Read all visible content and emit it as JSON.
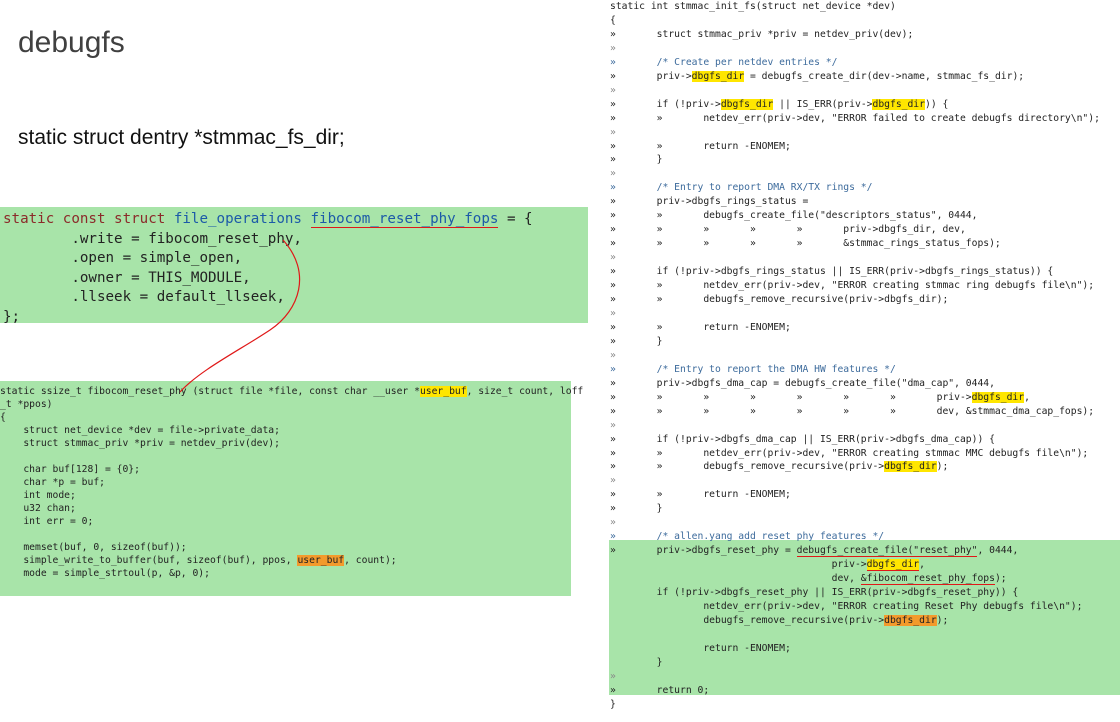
{
  "slide": {
    "title": "debugfs",
    "declaration": "static struct dentry *stmmac_fs_dir;"
  },
  "fops_block": {
    "line1_kw": "static const struct ",
    "line1_type": "file_operations",
    "line1_name": "fibocom_reset_phy_fops",
    "line1_end": " = {",
    "lines": [
      "        .write = fibocom_reset_phy,",
      "        .open = simple_open,",
      "        .owner = THIS_MODULE,",
      "        .llseek = default_llseek,",
      "};"
    ]
  },
  "reset_block": {
    "sig_a": "static ssize_t fibocom_reset_phy (struct file *file, const char __user *",
    "sig_hl": "user_buf",
    "sig_b": ", size_t count, loff",
    "sig_c": "_t *ppos)",
    "body_a": "{\n    struct net_device *dev = file->private_data;\n    struct stmmac_priv *priv = netdev_priv(dev);\n\n    char buf[128] = {0};\n    char *p = buf;\n    int mode;\n    u32 chan;\n    int err = 0;\n\n    memset(buf, 0, sizeof(buf));\n    simple_write_to_buffer(buf, sizeof(buf), ppos, ",
    "body_hl": "user_buf",
    "body_b": ", count);\n    mode = simple_strtoul(p, &p, 0);"
  },
  "right_code": {
    "l1": "static int stmmac_init_fs(struct net_device *dev)",
    "l2": "{",
    "l3": "»       struct stmmac_priv *priv = netdev_priv(dev);",
    "l5": "»       /* Create per netdev entries */",
    "l6a": "»       priv->",
    "l6b": " = debugfs_create_dir(dev->name, stmmac_fs_dir);",
    "l8a": "»       if (!priv->",
    "l8b": " || IS_ERR(priv->",
    "l8c": ")) {",
    "l9": "»       »       netdev_err(priv->dev, \"ERROR failed to create debugfs directory\\n\");",
    "l11": "»       »       return -ENOMEM;",
    "l12": "»       }",
    "l14": "»       /* Entry to report DMA RX/TX rings */",
    "l15": "»       priv->dbgfs_rings_status =",
    "l16": "»       »       debugfs_create_file(\"descriptors_status\", 0444,",
    "l17": "»       »       »       »       »       priv->dbgfs_dir, dev,",
    "l18": "»       »       »       »       »       &stmmac_rings_status_fops);",
    "l20": "»       if (!priv->dbgfs_rings_status || IS_ERR(priv->dbgfs_rings_status)) {",
    "l21": "»       »       netdev_err(priv->dev, \"ERROR creating stmmac ring debugfs file\\n\");",
    "l22": "»       »       debugfs_remove_recursive(priv->dbgfs_dir);",
    "l24": "»       »       return -ENOMEM;",
    "l25": "»       }",
    "l27": "»       /* Entry to report the DMA HW features */",
    "l28": "»       priv->dbgfs_dma_cap = debugfs_create_file(\"dma_cap\", 0444,",
    "l29a": "»       »       »       »       »       »       »       priv->",
    "l29b": ",",
    "l30": "»       »       »       »       »       »       »       dev, &stmmac_dma_cap_fops);",
    "l32": "»       if (!priv->dbgfs_dma_cap || IS_ERR(priv->dbgfs_dma_cap)) {",
    "l33": "»       »       netdev_err(priv->dev, \"ERROR creating stmmac MMC debugfs file\\n\");",
    "l34a": "»       »       debugfs_remove_recursive(priv->",
    "l34b": ");",
    "l36": "»       »       return -ENOMEM;",
    "l37": "»       }",
    "l39": "»       /* allen.yang add reset phy features */",
    "l40a": "»       priv->dbgfs_reset_phy = ",
    "l40b": "debugfs_create_file(\"reset_phy\"",
    "l40c": ", 0444,",
    "l41a": "                                      priv->",
    "l41b": ",",
    "l42a": "                                      dev, ",
    "l42b": "&fibocom_reset_phy_fops",
    "l42c": ");",
    "l43": "        if (!priv->dbgfs_reset_phy || IS_ERR(priv->dbgfs_reset_phy)) {",
    "l44": "                netdev_err(priv->dev, \"ERROR creating Reset Phy debugfs file\\n\");",
    "l45a": "                debugfs_remove_recursive(priv->",
    "l45b": ");",
    "l47": "                return -ENOMEM;",
    "l48": "        }",
    "l50": "»       return 0;",
    "l51": "}",
    "hl_word": "dbgfs_dir"
  }
}
